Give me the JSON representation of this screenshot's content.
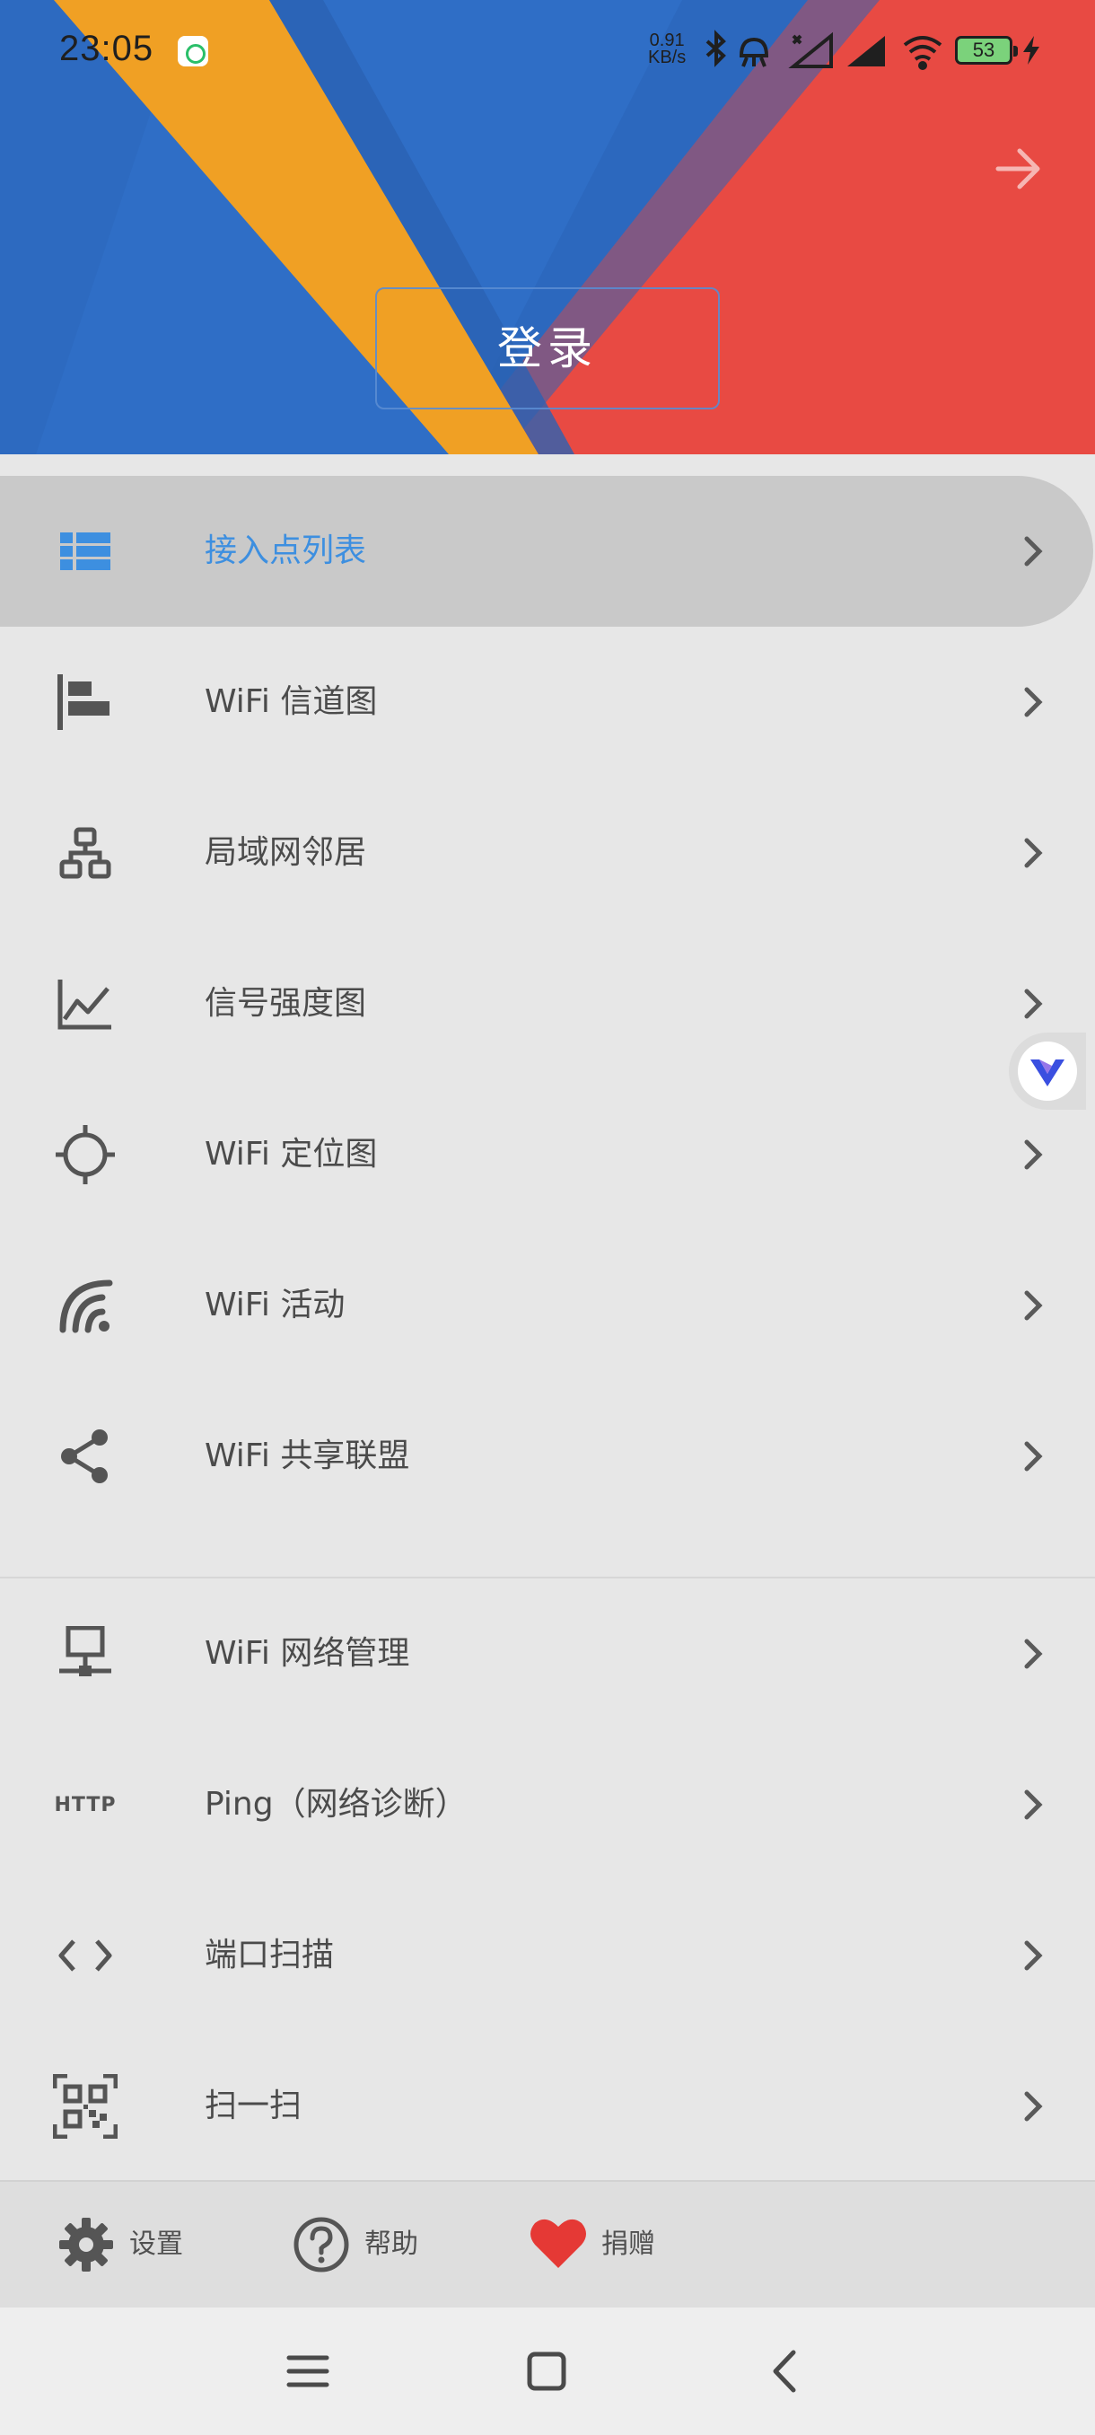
{
  "status_bar": {
    "time": "23:05",
    "net_speed_value": "0.91",
    "net_speed_unit": "KB/s",
    "battery": "53",
    "icons": [
      "app-notification-icon",
      "bluetooth-icon",
      "alarm-icon",
      "signal-icon",
      "signal-icon",
      "wifi-icon",
      "battery-icon",
      "charging-icon"
    ]
  },
  "header": {
    "login_label": "登录",
    "colors": {
      "blue": "#2f6ec6",
      "yellow": "#f0a024",
      "red": "#e84a43"
    }
  },
  "menu": {
    "accent": "#3d8fe0",
    "items": [
      {
        "label": "接入点列表",
        "icon": "list-icon",
        "active": true
      },
      {
        "label": "WiFi 信道图",
        "icon": "channel-chart-icon"
      },
      {
        "label": "局域网邻居",
        "icon": "network-topology-icon"
      },
      {
        "label": "信号强度图",
        "icon": "line-chart-icon"
      },
      {
        "label": "WiFi 定位图",
        "icon": "crosshair-icon"
      },
      {
        "label": "WiFi 活动",
        "icon": "wifi-signal-icon"
      },
      {
        "label": "WiFi 共享联盟",
        "icon": "share-icon"
      },
      {
        "label": "WiFi 网络管理",
        "icon": "monitor-network-icon"
      },
      {
        "label": "Ping（网络诊断）",
        "icon": "http-icon",
        "icon_text": "HTTP"
      },
      {
        "label": "端口扫描",
        "icon": "code-icon"
      },
      {
        "label": "扫一扫",
        "icon": "qr-scan-icon"
      }
    ]
  },
  "toolbar": {
    "settings_label": "设置",
    "help_label": "帮助",
    "donate_label": "捐赠",
    "donate_color": "#e53935"
  },
  "navbar": {
    "icons": [
      "menu-icon",
      "home-icon",
      "back-icon"
    ]
  }
}
